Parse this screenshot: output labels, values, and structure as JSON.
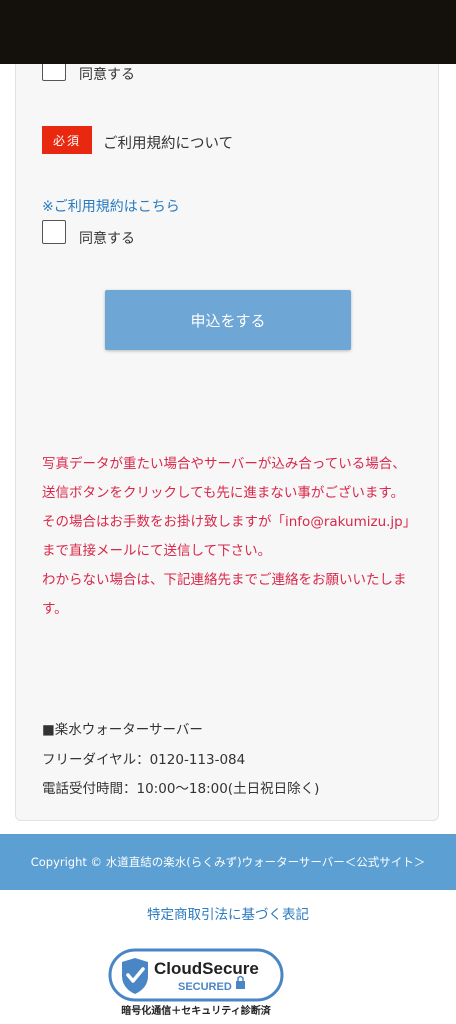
{
  "form": {
    "agree_label_1": "同意する",
    "required_badge": "必須",
    "terms_heading": "ご利用規約について",
    "terms_link": "※ご利用規約はこちら",
    "agree_label_2": "同意する",
    "submit_label": "申込をする"
  },
  "notice": {
    "lines": [
      "写真データが重たい場合やサーバーが込み合っている場合、送信ボタンをクリックしても先に進まない事がございます。",
      "その場合はお手数をお掛け致しますが「info@rakumizu.jp」まで直接メールにて送信して下さい。",
      "わからない場合は、下記連絡先までご連絡をお願いいたします。"
    ]
  },
  "contact": {
    "heading": "■楽水ウォーターサーバー",
    "phone": "フリーダイヤル：0120-113-084",
    "hours": "電話受付時間：10:00〜18:00(土日祝日除く)"
  },
  "footer": {
    "copyright": "Copyright ©  水道直結の楽水(らくみず)ウォーターサーバー＜公式サイト＞"
  },
  "tokusho_link": "特定商取引法に基づく表記",
  "seal": {
    "brand": "CloudSecure",
    "secured": "SECURED",
    "caption": "暗号化通信＋セキュリティ診断済"
  },
  "colors": {
    "accent_blue": "#5c9fd2",
    "button_blue": "#6ea6d6",
    "required_red": "#e8280f",
    "notice_red": "#d9284a",
    "link_blue": "#2a7bbf"
  }
}
